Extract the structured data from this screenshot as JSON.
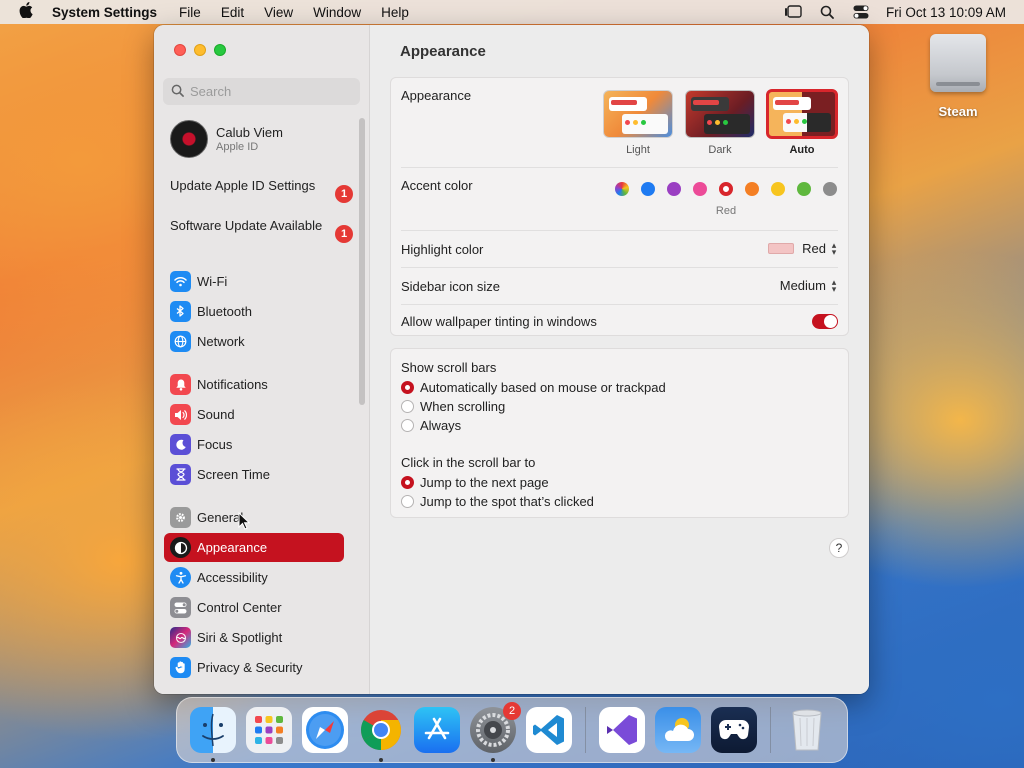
{
  "menubar": {
    "app_name": "System Settings",
    "items": [
      "File",
      "Edit",
      "View",
      "Window",
      "Help"
    ],
    "clock": "Fri Oct 13  10:09 AM",
    "status_icons": [
      "stage-manager-icon",
      "spotlight-search-icon",
      "control-center-icon"
    ]
  },
  "desktop": {
    "icons": [
      {
        "label": "Steam",
        "icon": "drive-icon"
      }
    ]
  },
  "window": {
    "sidebar": {
      "search_placeholder": "Search",
      "profile": {
        "name": "Calub Viem",
        "subtitle": "Apple ID"
      },
      "notices": [
        {
          "label": "Update Apple ID Settings",
          "badge": "1"
        },
        {
          "label": "Software Update Available",
          "badge": "1"
        }
      ],
      "items": [
        {
          "label": "Wi-Fi",
          "icon": "wifi-icon",
          "color": "#1e8bf3"
        },
        {
          "label": "Bluetooth",
          "icon": "bluetooth-icon",
          "color": "#1e8bf3"
        },
        {
          "label": "Network",
          "icon": "globe-icon",
          "color": "#1e8bf3"
        },
        {
          "label": "Notifications",
          "icon": "bell-icon",
          "color": "#f2484f"
        },
        {
          "label": "Sound",
          "icon": "speaker-icon",
          "color": "#f2484f"
        },
        {
          "label": "Focus",
          "icon": "moon-icon",
          "color": "#5b4fd6"
        },
        {
          "label": "Screen Time",
          "icon": "hourglass-icon",
          "color": "#5b4fd6"
        },
        {
          "label": "General",
          "icon": "gear-icon",
          "color": "#9a9a9a"
        },
        {
          "label": "Appearance",
          "icon": "appearance-icon",
          "color": "#1a1a1a",
          "active": true
        },
        {
          "label": "Accessibility",
          "icon": "accessibility-icon",
          "color": "#1e8bf3"
        },
        {
          "label": "Control Center",
          "icon": "control-center-icon",
          "color": "#8e8e93"
        },
        {
          "label": "Siri & Spotlight",
          "icon": "siri-icon",
          "color": "#7a4bd8"
        },
        {
          "label": "Privacy & Security",
          "icon": "hand-icon",
          "color": "#1e8bf3"
        }
      ]
    },
    "content": {
      "title": "Appearance",
      "appearance": {
        "label": "Appearance",
        "options": [
          {
            "label": "Light",
            "selected": false
          },
          {
            "label": "Dark",
            "selected": false
          },
          {
            "label": "Auto",
            "selected": true
          }
        ]
      },
      "accent_color": {
        "label": "Accent color",
        "selected_label": "Red",
        "colors": [
          "multicolor",
          "#1e7bf2",
          "#9a3fc2",
          "#ec4b98",
          "#d8262c",
          "#f47f24",
          "#f7c51f",
          "#5fb83e",
          "#8c8c8c"
        ]
      },
      "highlight_color": {
        "label": "Highlight color",
        "value": "Red"
      },
      "sidebar_icon_size": {
        "label": "Sidebar icon size",
        "value": "Medium"
      },
      "wallpaper_tinting": {
        "label": "Allow wallpaper tinting in windows",
        "on": true
      },
      "scroll_bars": {
        "label": "Show scroll bars",
        "options": [
          {
            "label": "Automatically based on mouse or trackpad",
            "selected": true
          },
          {
            "label": "When scrolling",
            "selected": false
          },
          {
            "label": "Always",
            "selected": false
          }
        ]
      },
      "click_scroll_bar": {
        "label": "Click in the scroll bar to",
        "options": [
          {
            "label": "Jump to the next page",
            "selected": true
          },
          {
            "label": "Jump to the spot that’s clicked",
            "selected": false
          }
        ]
      },
      "help_label": "?"
    }
  },
  "dock": {
    "items": [
      {
        "name": "finder-icon",
        "running": true
      },
      {
        "name": "launchpad-icon",
        "running": false
      },
      {
        "name": "safari-icon",
        "running": false
      },
      {
        "name": "chrome-icon",
        "running": true
      },
      {
        "name": "app-store-icon",
        "running": false
      },
      {
        "name": "system-settings-icon",
        "running": true,
        "badge": "2"
      },
      {
        "name": "vscode-icon",
        "running": false
      },
      {
        "name": "visual-studio-icon",
        "running": false
      },
      {
        "name": "weather-icon",
        "running": false
      },
      {
        "name": "steam-link-icon",
        "running": false
      },
      {
        "name": "trash-icon",
        "running": false
      }
    ]
  }
}
